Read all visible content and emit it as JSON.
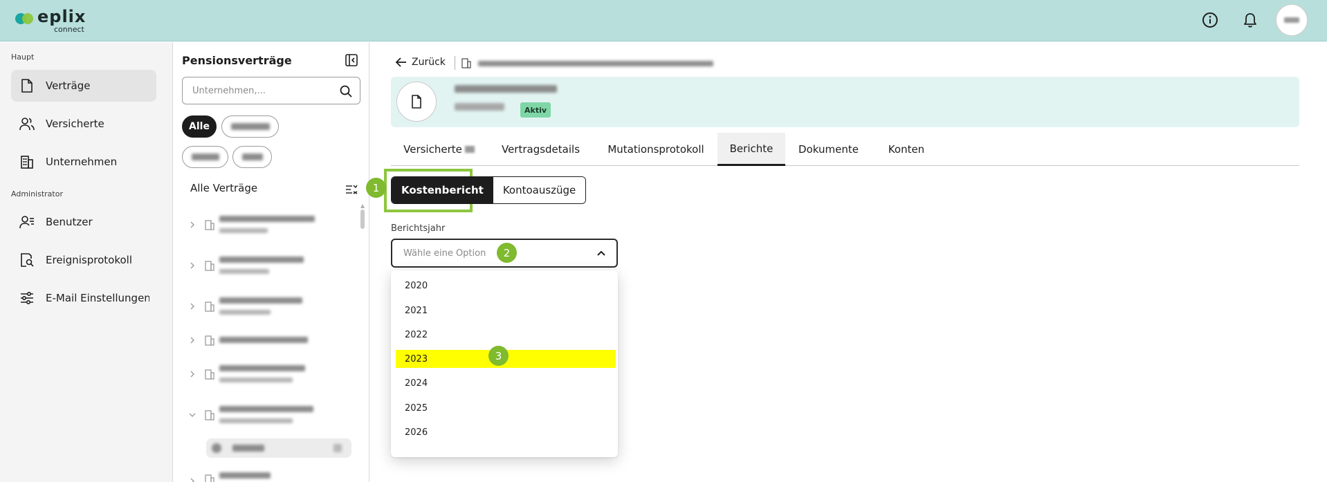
{
  "app": {
    "logo_word": "eplix",
    "logo_sub": "connect"
  },
  "header": {
    "icons": [
      "info-icon",
      "bell-icon",
      "avatar"
    ]
  },
  "sidebar": {
    "section_main": "Haupt",
    "section_admin": "Administrator",
    "items": [
      {
        "label": "Verträge",
        "icon": "document-icon",
        "active": true
      },
      {
        "label": "Versicherte",
        "icon": "people-icon",
        "active": false
      },
      {
        "label": "Unternehmen",
        "icon": "building-icon",
        "active": false
      },
      {
        "label": "Benutzer",
        "icon": "user-admin-icon",
        "active": false
      },
      {
        "label": "Ereignisprotokoll",
        "icon": "document-search-icon",
        "active": false
      },
      {
        "label": "E-Mail Einstellungen",
        "icon": "sliders-icon",
        "active": false
      }
    ]
  },
  "contracts_panel": {
    "title": "Pensionsverträge",
    "search_placeholder": "Unternehmen,...",
    "filter_active": "Alle",
    "list_header": "Alle Verträge"
  },
  "main": {
    "back_label": "Zurück",
    "status_badge": "Aktiv",
    "tabs": [
      {
        "label": "Versicherte",
        "active": false
      },
      {
        "label": "Vertragsdetails",
        "active": false
      },
      {
        "label": "Mutationsprotokoll",
        "active": false
      },
      {
        "label": "Berichte",
        "active": true
      },
      {
        "label": "Dokumente",
        "active": false
      },
      {
        "label": "Konten",
        "active": false
      }
    ],
    "report_types": [
      {
        "label": "Kostenbericht",
        "active": true
      },
      {
        "label": "Kontoauszüge",
        "active": false
      }
    ],
    "year_field": {
      "label": "Berichtsjahr",
      "placeholder": "Wähle eine Option",
      "options": [
        "2020",
        "2021",
        "2022",
        "2023",
        "2024",
        "2025",
        "2026"
      ],
      "highlighted": "2023"
    }
  },
  "markers": [
    "1",
    "2",
    "3"
  ],
  "colors": {
    "header_bg": "#b8dfdc",
    "card_bg": "#e2f4f2",
    "accent_green": "#8dc63f",
    "highlight": "#ffff00",
    "badge_green": "#7ed6a6"
  }
}
